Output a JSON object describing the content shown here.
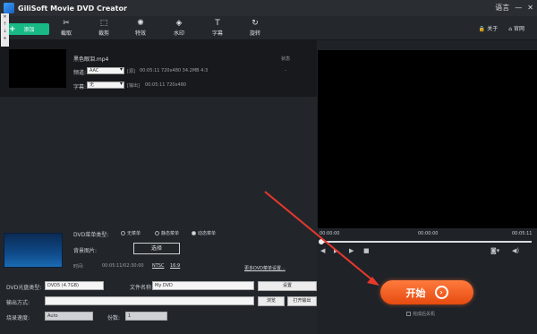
{
  "app": {
    "title": "GiliSoft Movie DVD Creator"
  },
  "window": {
    "language": "语言",
    "minimize": "—",
    "close": "✕"
  },
  "toolbar": {
    "add": "添加",
    "tools": [
      {
        "id": "trim",
        "icon": "✂",
        "label": "截取"
      },
      {
        "id": "crop",
        "icon": "⬚",
        "label": "裁剪"
      },
      {
        "id": "effect",
        "icon": "✺",
        "label": "特效"
      },
      {
        "id": "watermark",
        "icon": "◈",
        "label": "水印"
      },
      {
        "id": "subtitle",
        "icon": "T",
        "label": "字幕"
      },
      {
        "id": "rotate",
        "icon": "↻",
        "label": "旋转"
      }
    ],
    "about": "关于",
    "website": "官网"
  },
  "file": {
    "name": "黑色眼泪.mp4",
    "audio_label": "频道:",
    "audio_value": "AAC",
    "source_tag": "[源]",
    "source_meta": "00:05:11   720x480   34.2MB   4:3",
    "subtitle_label": "字幕:",
    "subtitle_value": "无",
    "output_tag": "[输出]",
    "output_meta": "00:05:11   720x480",
    "status_header": "状态",
    "status_value": "-"
  },
  "player": {
    "time_start": "00:00:00",
    "time_mid": "00:00:00",
    "time_end": "00:05:11"
  },
  "menu": {
    "type_label": "DVD菜单类型:",
    "options": [
      "无菜单",
      "静态菜单",
      "动态菜单"
    ],
    "selected": "动态菜单",
    "bg_label": "背景图片:",
    "choose": "选择",
    "time_label": "时间:",
    "time_value": "00:05:11/02:30:00",
    "ntsc": "NTSC",
    "ratio": "16:9",
    "more": "更多DVD菜单设置..."
  },
  "output": {
    "disc_type_label": "DVD光盘类型:",
    "disc_type_value": "DVD5 (4.7GB)",
    "file_name_label": "文件名称:",
    "file_name_value": "My DVD",
    "settings": "设置",
    "output_method_label": "输出方式:",
    "browse": "浏览",
    "open_output": "打开输出",
    "burn_speed_label": "烧录速度:",
    "burn_speed_value": "Auto",
    "copies_label": "份数:",
    "copies_value": "1"
  },
  "start": {
    "label": "开始",
    "shutdown": "完成后关机"
  }
}
